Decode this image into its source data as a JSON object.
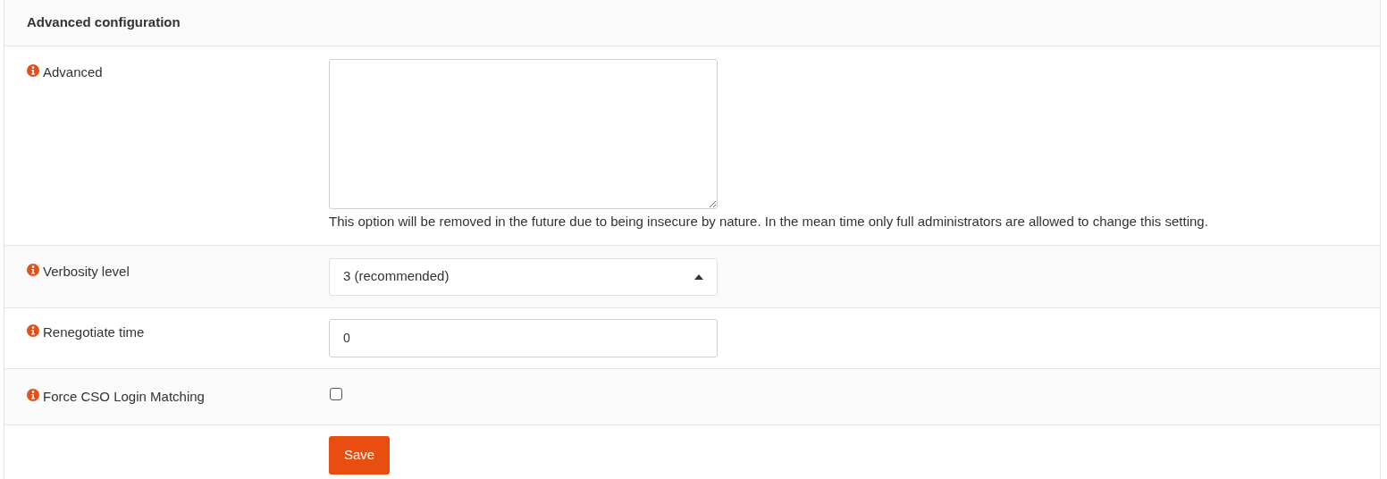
{
  "panel": {
    "title": "Advanced configuration"
  },
  "rows": [
    {
      "kind": "textarea",
      "label": "Advanced",
      "value": "",
      "help": "This option will be removed in the future due to being insecure by nature. In the mean time only full administrators are allowed to change this setting."
    },
    {
      "kind": "select",
      "label": "Verbosity level",
      "value": "3 (recommended)",
      "expanded": true
    },
    {
      "kind": "text",
      "label": "Renegotiate time",
      "value": "0"
    },
    {
      "kind": "checkbox",
      "label": "Force CSO Login Matching",
      "checked": false
    }
  ],
  "buttons": [
    {
      "label": "Save"
    }
  ]
}
